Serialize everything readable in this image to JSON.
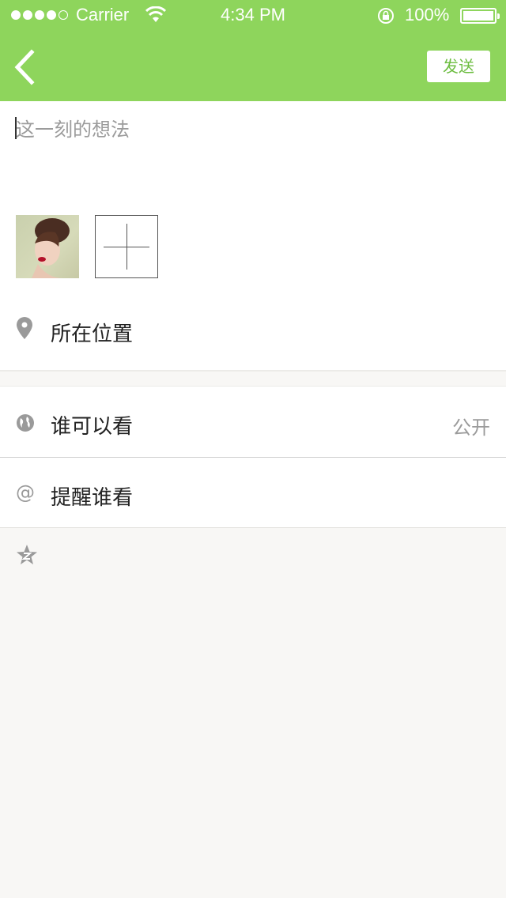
{
  "status_bar": {
    "carrier": "Carrier",
    "time": "4:34 PM",
    "battery": "100%",
    "signal_icon": "signal-dots-icon",
    "wifi_icon": "wifi-icon",
    "lock_icon": "rotation-lock-icon",
    "battery_icon": "battery-icon"
  },
  "nav": {
    "back_icon": "chevron-left-icon",
    "send_label": "发送",
    "bar_color": "#8ed55c",
    "accent_color": "#6dbd41"
  },
  "compose": {
    "placeholder": "这一刻的想法",
    "value": "",
    "add_photo_icon": "plus-icon"
  },
  "location": {
    "icon": "map-pin-icon",
    "label": "所在位置"
  },
  "visibility": {
    "icon": "globe-icon",
    "label": "谁可以看",
    "value": "公开"
  },
  "mention": {
    "icon": "at-icon",
    "icon_text": "@",
    "label": "提醒谁看"
  },
  "extra": {
    "icon": "qzone-star-icon"
  }
}
